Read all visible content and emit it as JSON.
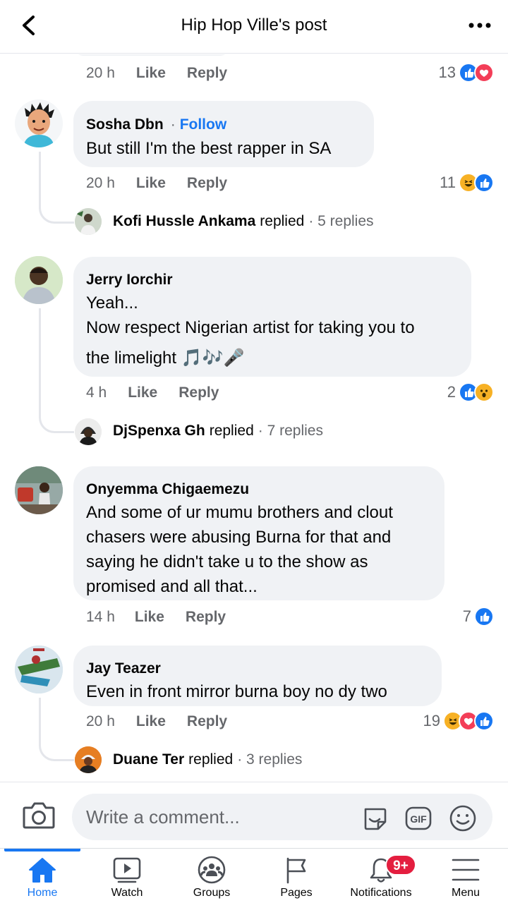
{
  "header": {
    "title": "Hip Hop Ville's post",
    "back_icon": "chevron-left-icon",
    "more_icon": "more-horizontal-icon"
  },
  "actions": {
    "like": "Like",
    "reply": "Reply"
  },
  "top_meta": {
    "time": "20 h",
    "reaction_count": "13",
    "reactions": [
      "like",
      "love"
    ]
  },
  "comments": [
    {
      "author": "Sosha Dbn",
      "follow": "Follow",
      "text": [
        "But still I'm the best rapper in SA"
      ],
      "time": "20 h",
      "reaction_count": "11",
      "reactions": [
        "haha",
        "like"
      ],
      "reply_preview": {
        "name": "Kofi Hussle Ankama",
        "verb": "replied",
        "count": "· 5 replies"
      }
    },
    {
      "author": "Jerry Iorchir",
      "text": [
        "Yeah...",
        "Now respect Nigerian artist for taking you to",
        "the limelight 🎵🎶🎤"
      ],
      "time": "4 h",
      "reaction_count": "2",
      "reactions": [
        "like",
        "wow"
      ],
      "reply_preview": {
        "name": "DjSpenxa Gh",
        "verb": "replied",
        "count": "· 7 replies"
      }
    },
    {
      "author": "Onyemma Chigaemezu",
      "text": [
        "And some of ur mumu brothers and clout",
        "chasers were abusing Burna for that and",
        "saying he didn't take u to the show as",
        "promised and all that..."
      ],
      "time": "14 h",
      "reaction_count": "7",
      "reactions": [
        "like"
      ]
    },
    {
      "author": "Jay Teazer",
      "text": [
        "Even in front  mirror burna boy no dy two"
      ],
      "time": "20 h",
      "reaction_count": "19",
      "reactions": [
        "haha",
        "love",
        "like"
      ],
      "reply_preview": {
        "name": "Duane Ter",
        "verb": "replied",
        "count": "· 3 replies"
      }
    }
  ],
  "composer": {
    "placeholder": "Write a comment...",
    "gif_label": "GIF"
  },
  "nav": [
    {
      "label": "Home",
      "icon": "home-icon",
      "active": true
    },
    {
      "label": "Watch",
      "icon": "watch-icon"
    },
    {
      "label": "Groups",
      "icon": "groups-icon"
    },
    {
      "label": "Pages",
      "icon": "flag-icon"
    },
    {
      "label": "Notifications",
      "icon": "bell-icon",
      "badge": "9+"
    },
    {
      "label": "Menu",
      "icon": "menu-icon"
    }
  ],
  "colors": {
    "accent": "#1877f2",
    "like": "#1877f2",
    "love": "#f33e58",
    "haha": "#f7b125",
    "badge": "#e41e3f",
    "bubble": "#f0f2f5",
    "secondary_text": "#65676b"
  }
}
